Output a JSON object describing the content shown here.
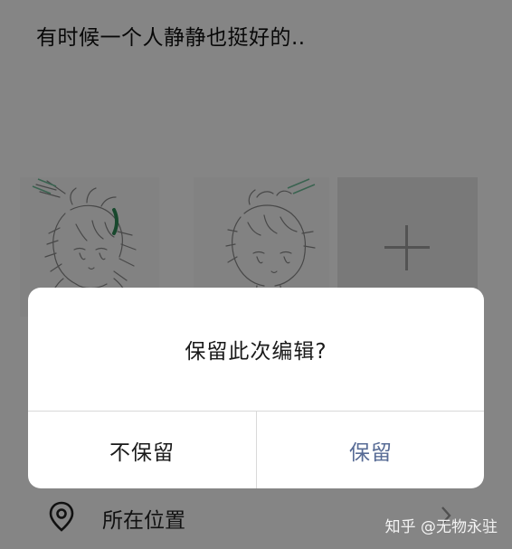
{
  "post": {
    "text": "有时候一个人静静也挺好的.."
  },
  "photos": [
    {
      "description": "anime-sketch-character-1"
    },
    {
      "description": "anime-sketch-character-2"
    }
  ],
  "location": {
    "label": "所在位置"
  },
  "dialog": {
    "message": "保留此次编辑?",
    "discard_label": "不保留",
    "keep_label": "保留"
  },
  "watermark": {
    "text": "知乎 @无物永驻"
  },
  "colors": {
    "overlay": "#000000",
    "dialog_bg": "#ffffff",
    "keep_text": "#576b95",
    "discard_text": "#1a1a1a",
    "add_tile_bg": "#e9e9e9"
  }
}
